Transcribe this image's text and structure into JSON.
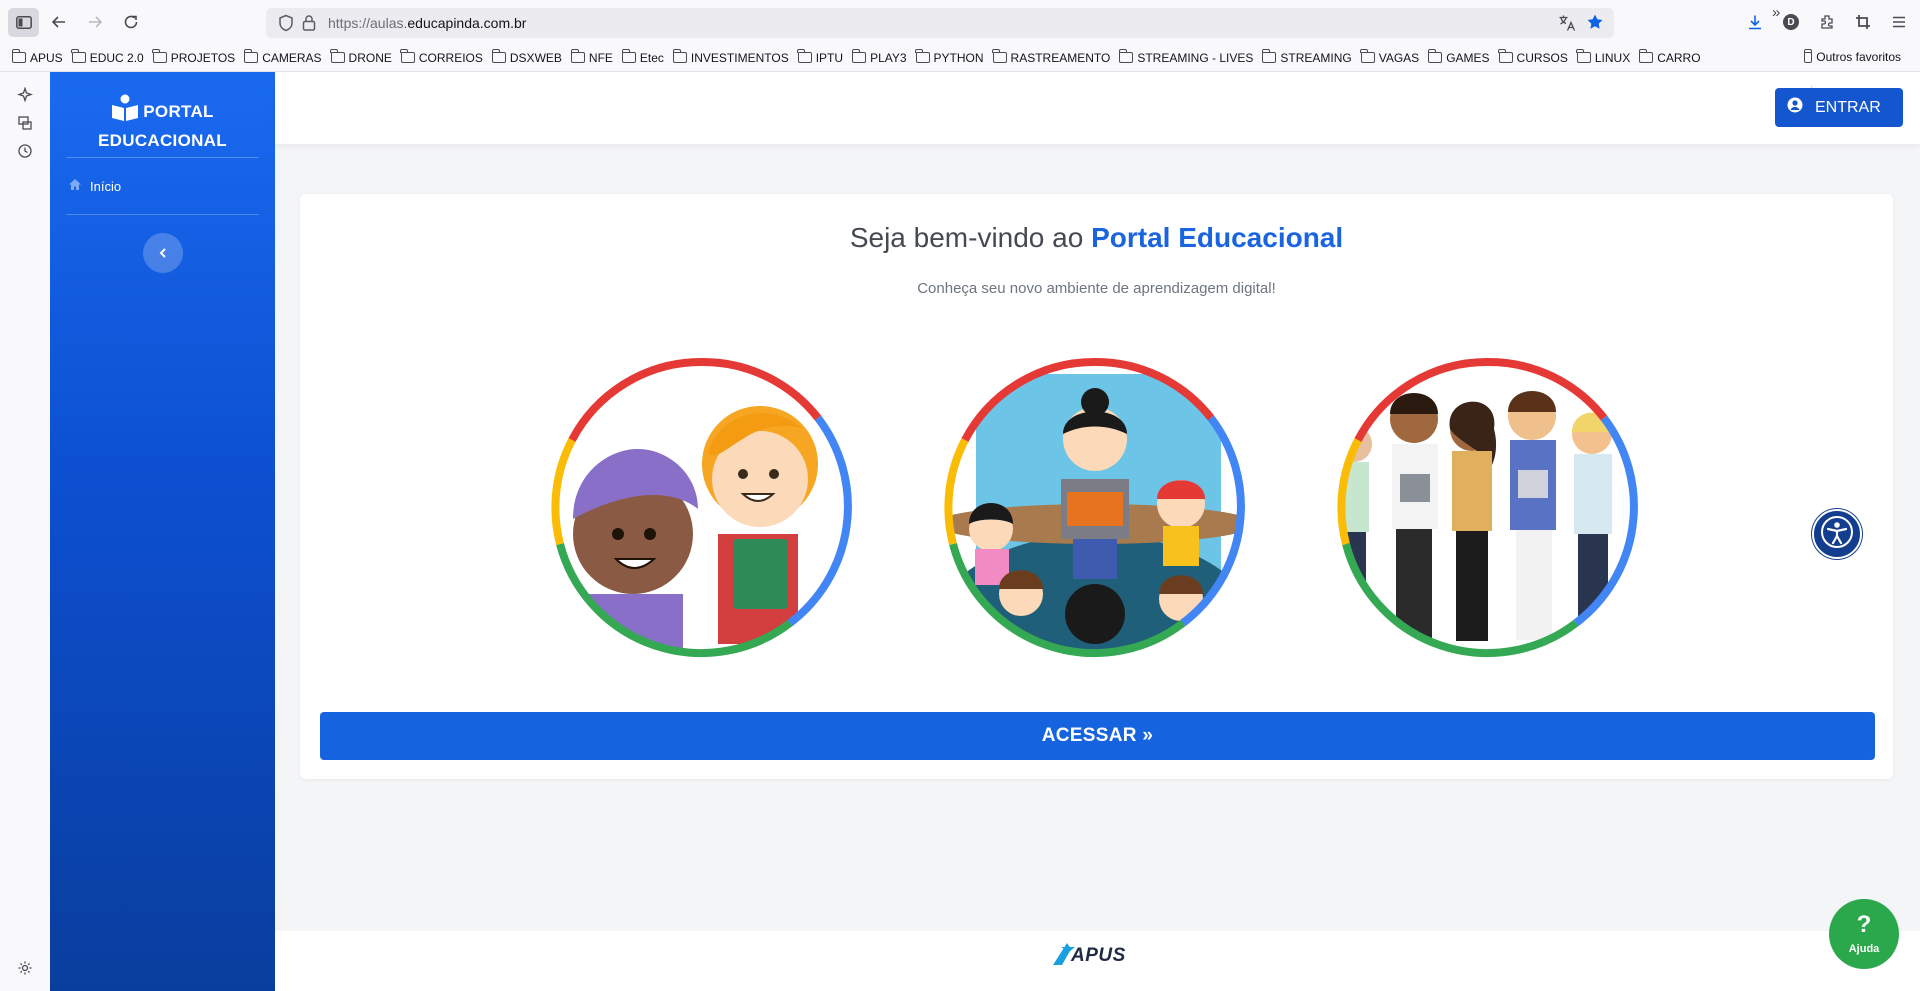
{
  "browser": {
    "url_prefix": "https://aulas.",
    "url_domain": "educapinda.com.br",
    "bookmarks": [
      "APUS",
      "EDUC 2.0",
      "PROJETOS",
      "CAMERAS",
      "DRONE",
      "CORREIOS",
      "DSXWEB",
      "NFE",
      "Etec",
      "INVESTIMENTOS",
      "IPTU",
      "PLAY3",
      "PYTHON",
      "RASTREAMENTO",
      "STREAMING - LIVES",
      "STREAMING",
      "VAGAS",
      "GAMES",
      "CURSOS",
      "LINUX",
      "CARRO"
    ],
    "other_favorites": "Outros favoritos",
    "profile_initial": "D"
  },
  "sidebar": {
    "brand_line1": "PORTAL",
    "brand_line2": "EDUCACIONAL",
    "nav_home": "Início"
  },
  "header": {
    "login_label": "ENTRAR"
  },
  "main": {
    "welcome_prefix": "Seja bem-vindo ao ",
    "welcome_highlight": "Portal Educacional",
    "subtitle": "Conheça seu novo ambiente de aprendizagem digital!",
    "access_label": "ACESSAR »"
  },
  "footer": {
    "logo_text": "APUS"
  },
  "help": {
    "icon": "?",
    "label": "Ajuda"
  },
  "colors": {
    "brand_blue": "#1663e0",
    "ring_red": "#e53935",
    "ring_blue": "#4285f4",
    "ring_green": "#34a853",
    "ring_yellow": "#fbbc05"
  }
}
